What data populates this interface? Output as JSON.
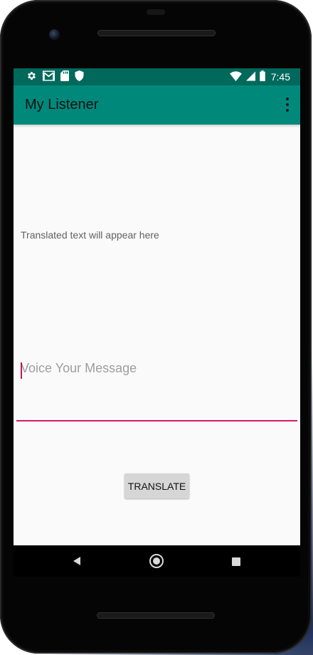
{
  "status_bar": {
    "time": "7:45",
    "left_icons": [
      "gear-icon",
      "gmail-icon",
      "sd-card-icon",
      "shield-icon"
    ],
    "right_icons": [
      "wifi-icon",
      "signal-icon",
      "battery-icon"
    ],
    "background_color": "#00695c"
  },
  "app_bar": {
    "title": "My Listener",
    "background_color": "#00897b",
    "overflow_icon": "more-vert-icon"
  },
  "main": {
    "translated_text": "Translated text will appear here",
    "message_input": {
      "placeholder": "Voice Your Message",
      "value": "",
      "underline_color": "#d81b60"
    },
    "translate_button_label": "TRANSLATE"
  },
  "nav_bar": {
    "buttons": [
      "back-icon",
      "home-icon",
      "recents-icon"
    ]
  }
}
